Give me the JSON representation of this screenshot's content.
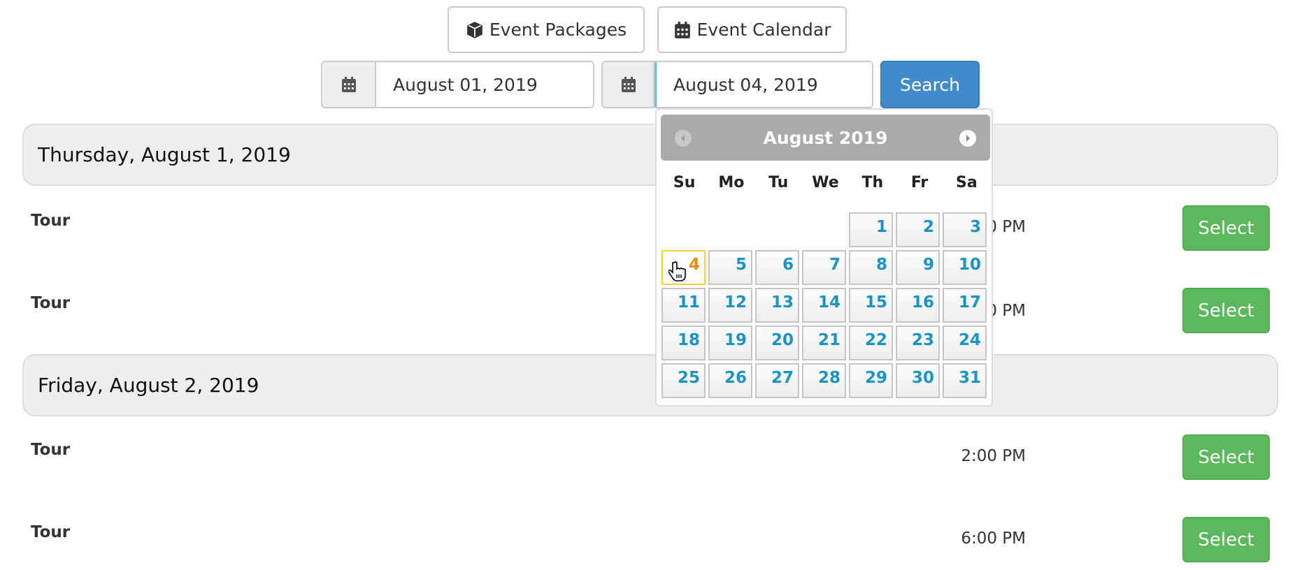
{
  "toolbar": {
    "packages_label": "Event Packages",
    "calendar_label": "Event Calendar"
  },
  "search": {
    "start_date": "August 01, 2019",
    "end_date": "August 04, 2019",
    "button_label": "Search"
  },
  "datepicker": {
    "title": "August 2019",
    "weekdays": [
      "Su",
      "Mo",
      "Tu",
      "We",
      "Th",
      "Fr",
      "Sa"
    ],
    "weeks": [
      [
        null,
        null,
        null,
        null,
        1,
        2,
        3
      ],
      [
        4,
        5,
        6,
        7,
        8,
        9,
        10
      ],
      [
        11,
        12,
        13,
        14,
        15,
        16,
        17
      ],
      [
        18,
        19,
        20,
        21,
        22,
        23,
        24
      ],
      [
        25,
        26,
        27,
        28,
        29,
        30,
        31
      ]
    ],
    "highlighted_day": 4
  },
  "days": [
    {
      "heading": "Thursday, August 1, 2019",
      "events": [
        {
          "name": "Tour",
          "time": "2:00 PM",
          "action": "Select"
        },
        {
          "name": "Tour",
          "time": "6:00 PM",
          "action": "Select"
        }
      ]
    },
    {
      "heading": "Friday, August 2, 2019",
      "events": [
        {
          "name": "Tour",
          "time": "2:00 PM",
          "action": "Select"
        },
        {
          "name": "Tour",
          "time": "6:00 PM",
          "action": "Select"
        }
      ]
    }
  ],
  "colors": {
    "select": "#5cb85c",
    "search": "#428bca",
    "day_link": "#1a94c6",
    "highlight": "#ee8a00"
  }
}
